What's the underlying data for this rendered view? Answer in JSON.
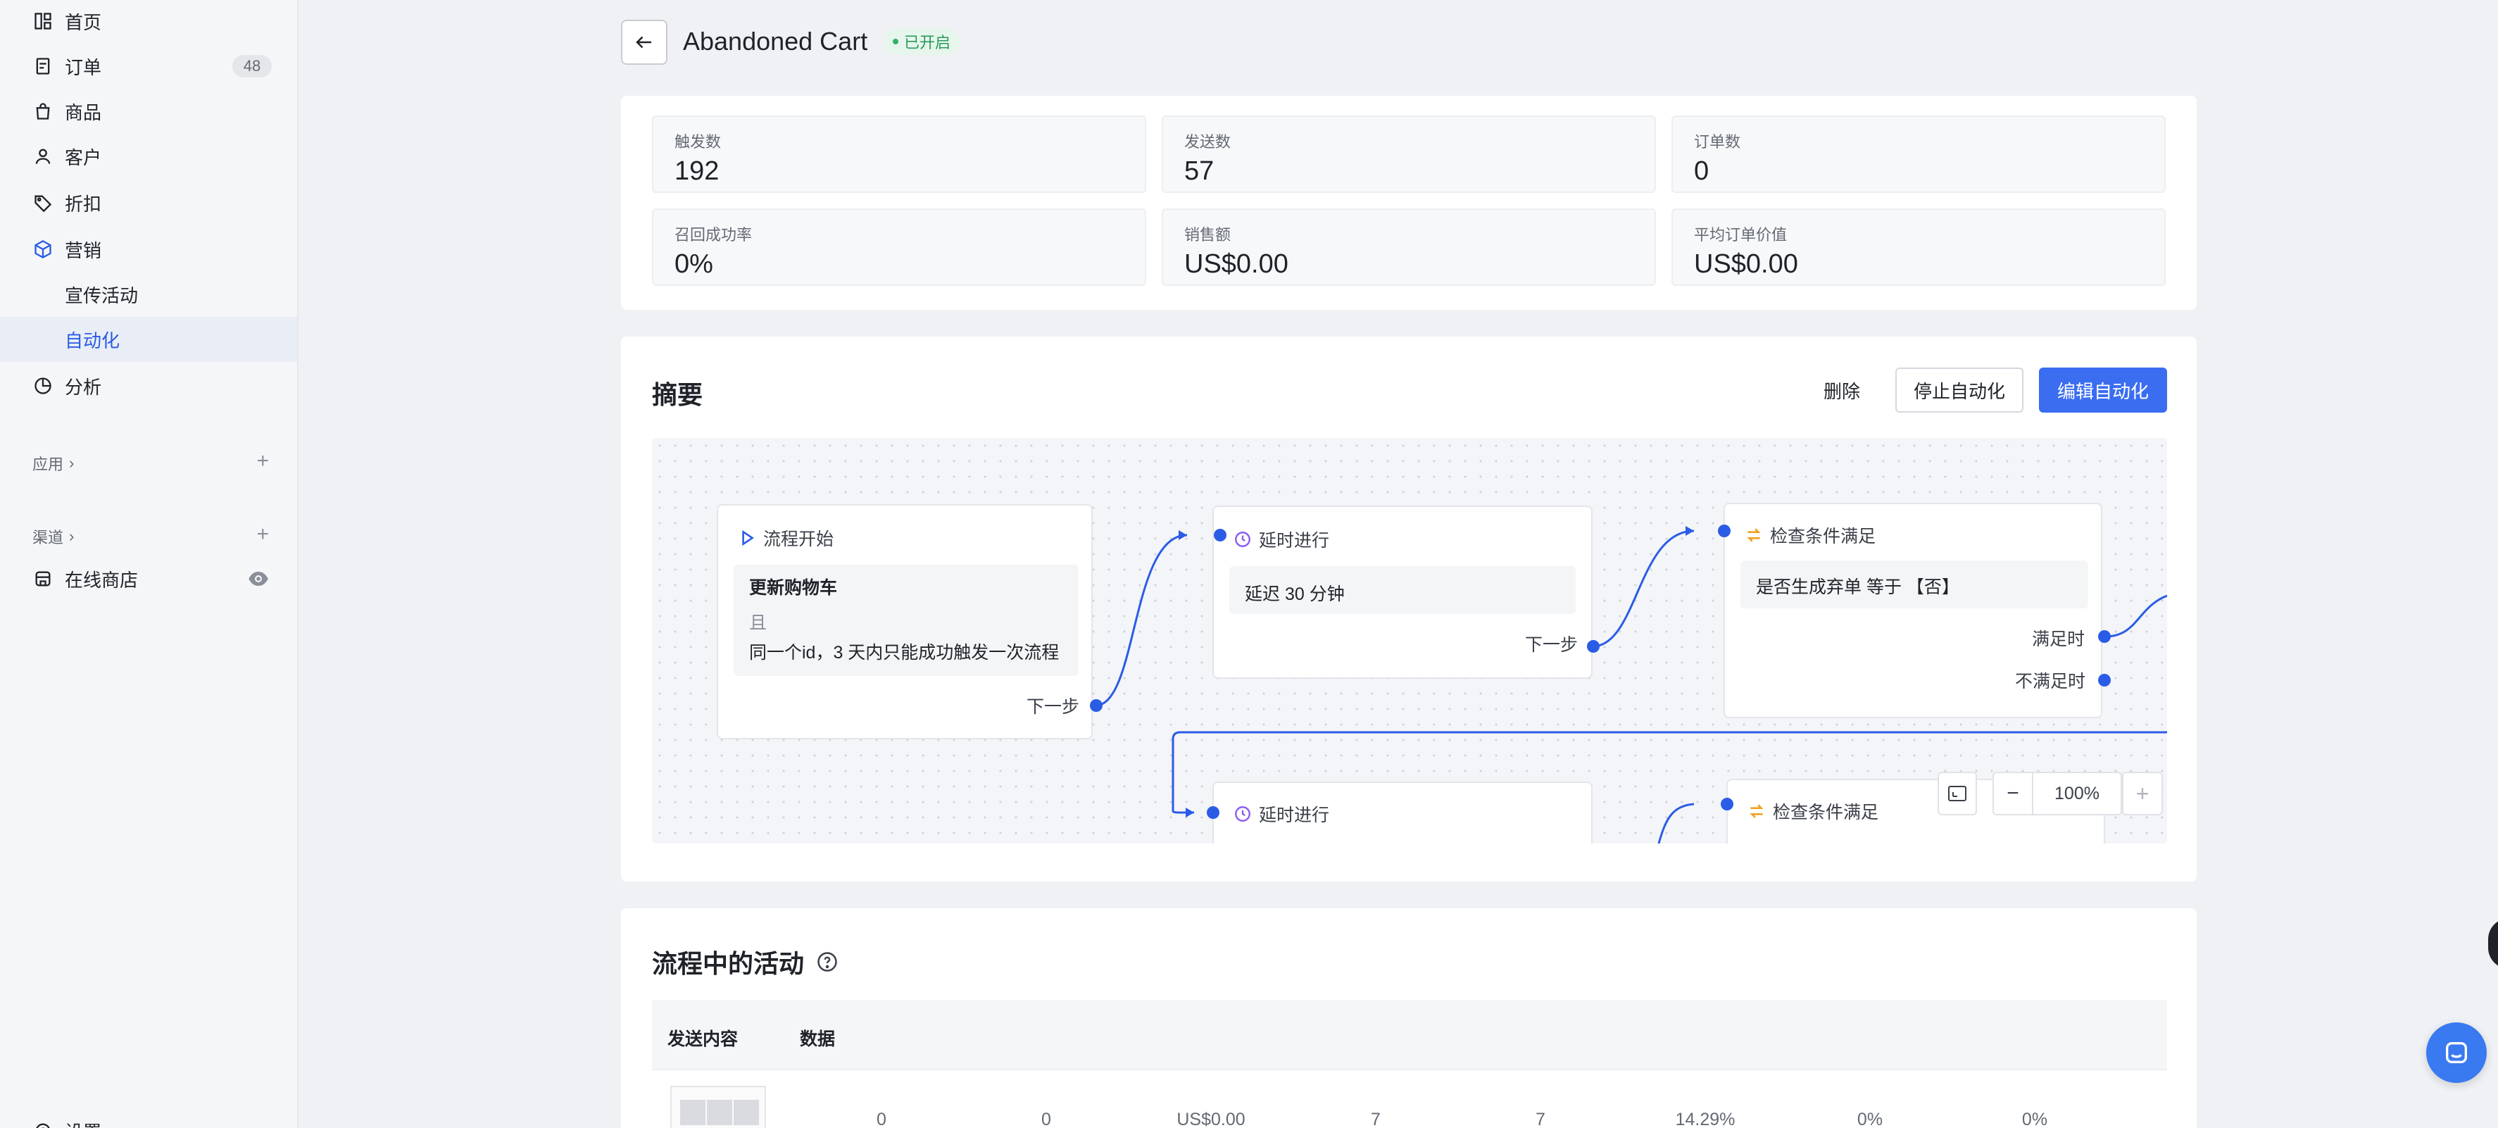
{
  "sidebar": {
    "items": [
      {
        "label": "首页",
        "icon": "dashboard-icon"
      },
      {
        "label": "订单",
        "icon": "order-icon",
        "badge": "48"
      },
      {
        "label": "商品",
        "icon": "bag-icon"
      },
      {
        "label": "客户",
        "icon": "user-icon"
      },
      {
        "label": "折扣",
        "icon": "tag-icon"
      },
      {
        "label": "营销",
        "icon": "cube-icon"
      },
      {
        "label": "宣传活动"
      },
      {
        "label": "自动化"
      },
      {
        "label": "分析",
        "icon": "pie-icon"
      }
    ],
    "apps_label": "应用",
    "channels_label": "渠道",
    "online_store": "在线商店",
    "settings": "设置"
  },
  "header": {
    "title": "Abandoned Cart",
    "status": "已开启"
  },
  "stats": [
    {
      "label": "触发数",
      "value": "192"
    },
    {
      "label": "发送数",
      "value": "57"
    },
    {
      "label": "订单数",
      "value": "0"
    },
    {
      "label": "召回成功率",
      "value": "0%"
    },
    {
      "label": "销售额",
      "value": "US$0.00"
    },
    {
      "label": "平均订单价值",
      "value": "US$0.00"
    }
  ],
  "summary": {
    "title": "摘要",
    "delete": "删除",
    "stop": "停止自动化",
    "edit": "编辑自动化"
  },
  "flow": {
    "start": {
      "title": "流程开始",
      "event": "更新购物车",
      "and": "且",
      "rule": "同一个id，3 天内只能成功触发一次流程",
      "next": "下一步"
    },
    "delay1": {
      "title": "延时进行",
      "body": "延迟 30 分钟",
      "next": "下一步"
    },
    "check1": {
      "title": "检查条件满足",
      "body": "是否生成弃单 等于 【否】",
      "yes": "满足时",
      "no": "不满足时"
    },
    "delay2": {
      "title": "延时进行"
    },
    "check2": {
      "title": "检查条件满足"
    },
    "zoom": "100%"
  },
  "activity": {
    "title": "流程中的活动",
    "col_content": "发送内容",
    "col_data": "数据",
    "row": [
      "0",
      "0",
      "US$0.00",
      "7",
      "7",
      "14.29%",
      "0%",
      "0%"
    ]
  }
}
